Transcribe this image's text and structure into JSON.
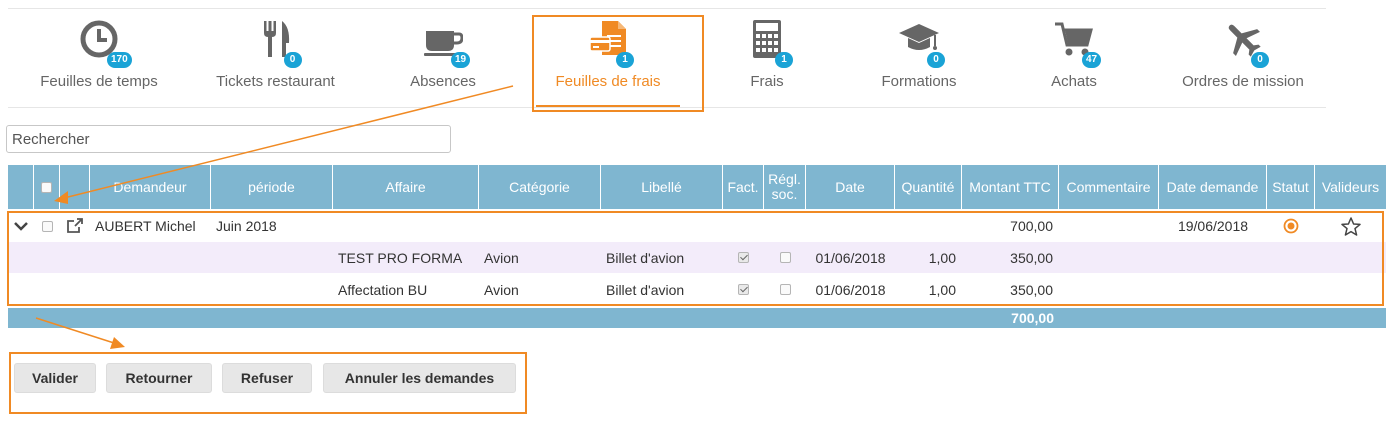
{
  "colors": {
    "accent": "#f08a24",
    "header_bg": "#7fb6d0",
    "badge": "#1aa3d6",
    "subrow_bg": "#f3ecfa"
  },
  "tabs": [
    {
      "label": "Feuilles de temps",
      "badge": "170",
      "icon": "clock-icon"
    },
    {
      "label": "Tickets restaurant",
      "badge": "0",
      "icon": "fork-knife-icon"
    },
    {
      "label": "Absences",
      "badge": "19",
      "icon": "coffee-cup-icon"
    },
    {
      "label": "Feuilles de frais",
      "badge": "1",
      "icon": "expense-document-icon",
      "active": true
    },
    {
      "label": "Frais",
      "badge": "1",
      "icon": "calculator-icon"
    },
    {
      "label": "Formations",
      "badge": "0",
      "icon": "graduation-cap-icon"
    },
    {
      "label": "Achats",
      "badge": "47",
      "icon": "shopping-cart-icon"
    },
    {
      "label": "Ordres de mission",
      "badge": "0",
      "icon": "airplane-icon"
    }
  ],
  "search": {
    "placeholder": "Rechercher"
  },
  "table": {
    "headers": {
      "demandeur": "Demandeur",
      "periode": "période",
      "affaire": "Affaire",
      "categorie": "Catégorie",
      "libelle": "Libellé",
      "fact": "Fact.",
      "regl_line1": "Régl.",
      "regl_line2": "soc.",
      "date": "Date",
      "quantite": "Quantité",
      "montant": "Montant TTC",
      "commentaire": "Commentaire",
      "date_demande": "Date demande",
      "statut": "Statut",
      "valideurs": "Valideurs"
    },
    "main_row": {
      "demandeur": "AUBERT Michel",
      "periode": "Juin 2018",
      "montant": "700,00",
      "date_demande": "19/06/2018"
    },
    "lines": [
      {
        "affaire": "TEST PRO FORMA",
        "categorie": "Avion",
        "libelle": "Billet d'avion",
        "fact": true,
        "regl": false,
        "date": "01/06/2018",
        "quantite": "1,00",
        "montant": "350,00"
      },
      {
        "affaire": "Affectation BU",
        "categorie": "Avion",
        "libelle": "Billet d'avion",
        "fact": true,
        "regl": false,
        "date": "01/06/2018",
        "quantite": "1,00",
        "montant": "350,00"
      }
    ],
    "total": "700,00"
  },
  "actions": {
    "valider": "Valider",
    "retourner": "Retourner",
    "refuser": "Refuser",
    "annuler": "Annuler les demandes"
  }
}
